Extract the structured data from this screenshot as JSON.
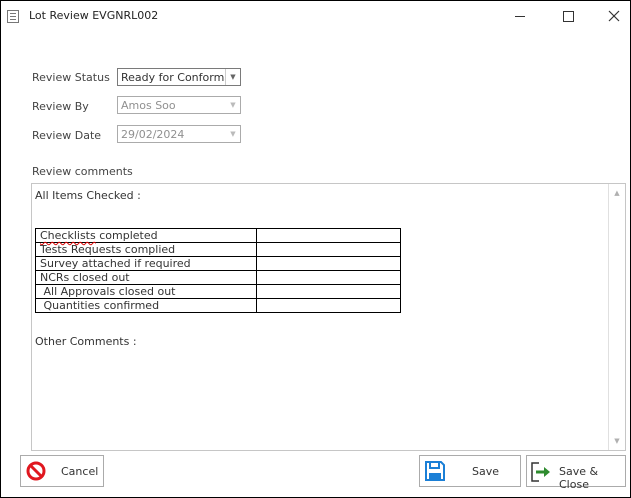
{
  "window": {
    "title": "Lot Review EVGNRL002"
  },
  "form": {
    "review_status_label": "Review Status",
    "review_status_value": "Ready for Conforma...",
    "review_by_label": "Review By",
    "review_by_value": "Amos  Soo",
    "review_date_label": "Review Date",
    "review_date_value": "29/02/2024",
    "comments_label": "Review comments"
  },
  "comments": {
    "heading": "All Items Checked :",
    "checklist_first_word": "Checklists",
    "checklist_rest": " completed",
    "rows": [
      "Tests Requests complied",
      "Survey attached if required",
      "NCRs closed out",
      " All Approvals closed out",
      " Quantities confirmed"
    ],
    "other": "Other Comments :"
  },
  "buttons": {
    "cancel": "Cancel",
    "save": "Save",
    "save_close": "Save & Close"
  },
  "colors": {
    "cancel_icon": "#e0171f",
    "save_icon": "#1b7fd6",
    "save_close_arrow": "#2e8b2e"
  }
}
